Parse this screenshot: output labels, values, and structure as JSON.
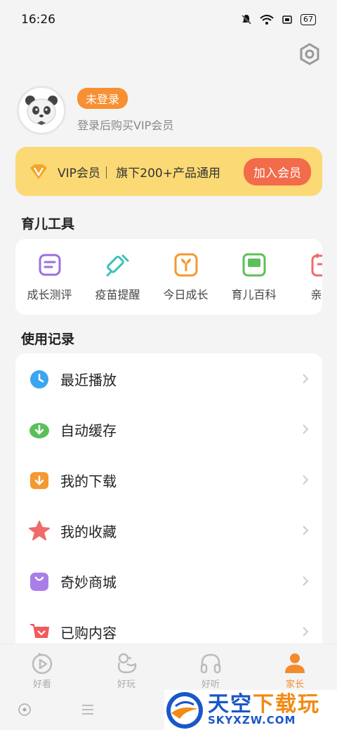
{
  "status_bar": {
    "time": "16:26",
    "battery": "67"
  },
  "profile": {
    "login_badge": "未登录",
    "hint": "登录后购买VIP会员"
  },
  "vip": {
    "text": "VIP会员｜ 旗下200+产品通用",
    "button": "加入会员"
  },
  "tools": {
    "title": "育儿工具",
    "items": [
      {
        "label": "成长测评",
        "icon": "clipboard-icon",
        "color": "#9b6fe0"
      },
      {
        "label": "疫苗提醒",
        "icon": "syringe-icon",
        "color": "#3cc0b8"
      },
      {
        "label": "今日成长",
        "icon": "sprout-icon",
        "color": "#f5982f"
      },
      {
        "label": "育儿百科",
        "icon": "book-icon",
        "color": "#5cc05a"
      },
      {
        "label": "亲子",
        "icon": "calendar-icon",
        "color": "#f06a6a"
      }
    ]
  },
  "records": {
    "title": "使用记录",
    "items": [
      {
        "label": "最近播放",
        "icon": "clock-icon",
        "color": "#3aa6f0"
      },
      {
        "label": "自动缓存",
        "icon": "cloud-download-icon",
        "color": "#5cc05a"
      },
      {
        "label": "我的下载",
        "icon": "folder-download-icon",
        "color": "#f5982f"
      },
      {
        "label": "我的收藏",
        "icon": "star-icon",
        "color": "#f06a6a"
      },
      {
        "label": "奇妙商城",
        "icon": "shopping-bag-icon",
        "color": "#a97ee8"
      },
      {
        "label": "已购内容",
        "icon": "cart-icon",
        "color": "#f05a5a"
      }
    ]
  },
  "nav": {
    "items": [
      {
        "label": "好看",
        "icon": "play-icon",
        "active": false
      },
      {
        "label": "好玩",
        "icon": "duck-icon",
        "active": false
      },
      {
        "label": "好听",
        "icon": "headphones-icon",
        "active": false
      },
      {
        "label": "家长",
        "icon": "person-icon",
        "active": true
      }
    ]
  },
  "watermark": {
    "title_a": "天空",
    "title_b": "下载玩",
    "domain": "SKYXZW.COM"
  },
  "colors": {
    "accent": "#f58a2d",
    "vip_bg": "#fbd974",
    "vip_button": "#f26b4a"
  }
}
